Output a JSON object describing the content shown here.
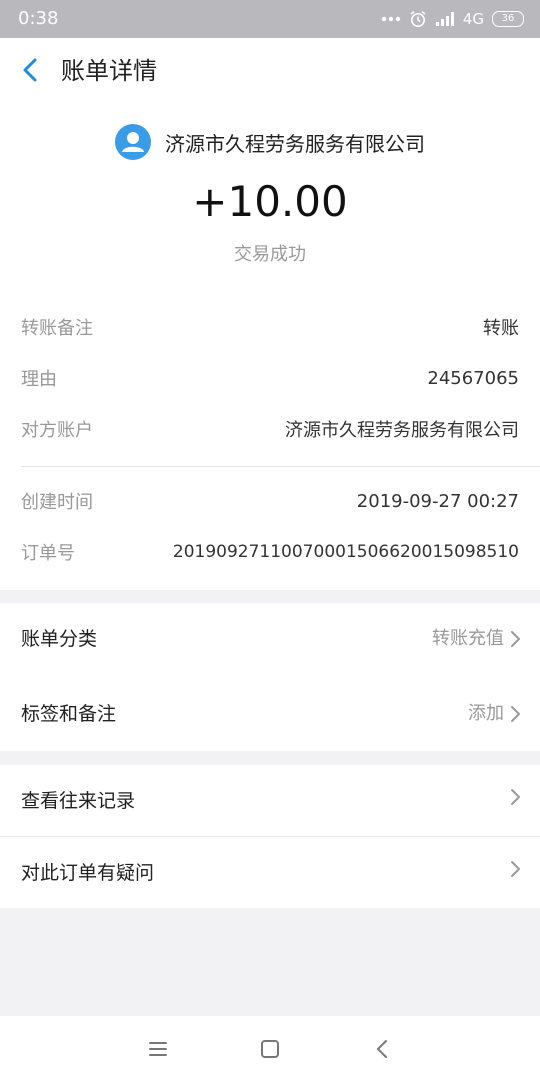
{
  "status_bar": {
    "time": "0:38",
    "network": "4G",
    "battery": "36",
    "icons": [
      "more-dots-icon",
      "alarm-icon",
      "signal-icon"
    ]
  },
  "header": {
    "title": "账单详情",
    "back_icon": "chevron-left-icon"
  },
  "summary": {
    "payee": "济源市久程劳务服务有限公司",
    "amount": "+10.00",
    "status": "交易成功",
    "avatar_icon": "user-avatar-icon"
  },
  "details": {
    "rows": [
      {
        "label": "转账备注",
        "value": "转账"
      },
      {
        "label": "理由",
        "value": "24567065"
      },
      {
        "label": "对方账户",
        "value": "济源市久程劳务服务有限公司"
      },
      {
        "label": "创建时间",
        "value": "2019-09-27 00:27"
      },
      {
        "label": "订单号",
        "value": "20190927110070001506620015098510"
      }
    ]
  },
  "category_group": {
    "rows": [
      {
        "label": "账单分类",
        "value": "转账充值"
      },
      {
        "label": "标签和备注",
        "value": "添加"
      }
    ]
  },
  "action_group": {
    "rows": [
      {
        "label": "查看往来记录"
      },
      {
        "label": "对此订单有疑问"
      }
    ]
  },
  "nav_bar": {
    "icons": [
      "menu-icon",
      "home-square-icon",
      "back-triangle-icon"
    ]
  },
  "colors": {
    "accent": "#1e8cd8",
    "background": "#f2f2f5",
    "status_bar": "#b9b9bd",
    "muted_text": "#999999"
  }
}
